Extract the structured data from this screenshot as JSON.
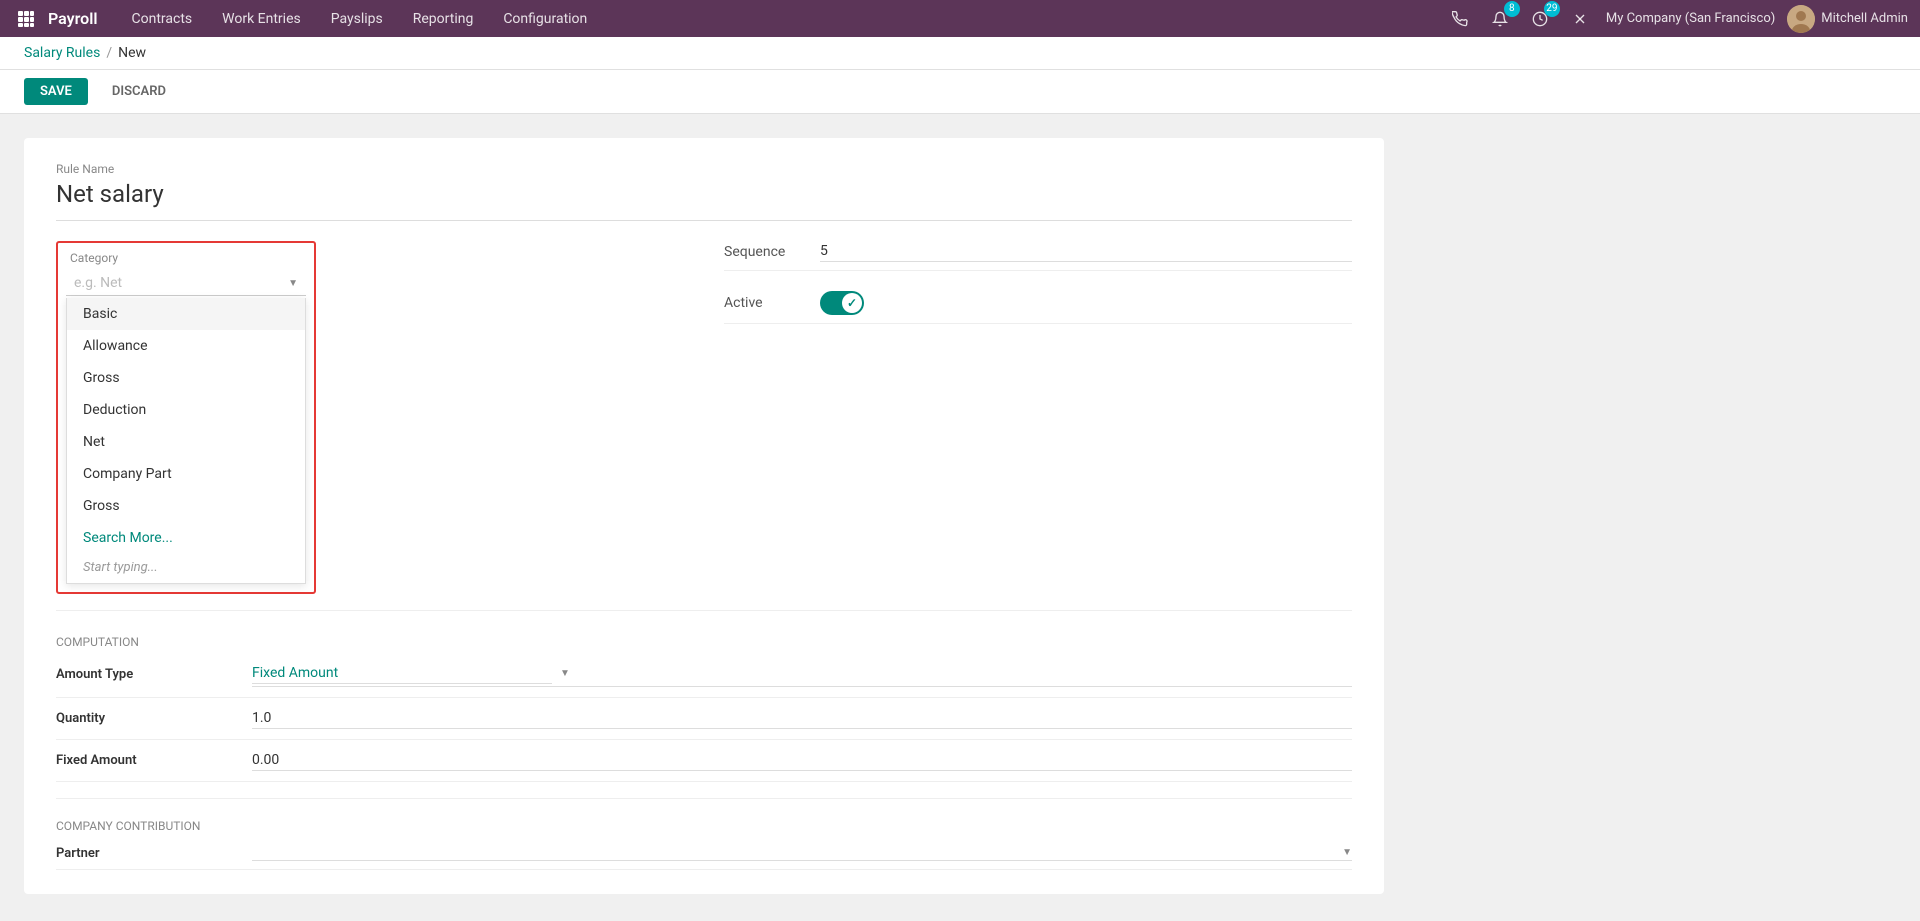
{
  "app": {
    "brand": "Payroll",
    "nav_items": [
      "Contracts",
      "Work Entries",
      "Payslips",
      "Reporting",
      "Configuration"
    ]
  },
  "header": {
    "breadcrumb_parent": "Salary Rules",
    "breadcrumb_separator": "/",
    "breadcrumb_current": "New"
  },
  "actions": {
    "save_label": "SAVE",
    "discard_label": "DISCARD"
  },
  "form": {
    "rule_name_label": "Rule Name",
    "rule_name_value": "Net salary",
    "category_label": "Category",
    "category_placeholder": "e.g. Net",
    "sequence_label": "Sequence",
    "sequence_value": "5",
    "active_label": "Active"
  },
  "dropdown": {
    "items": [
      "Basic",
      "Allowance",
      "Gross",
      "Deduction",
      "Net",
      "Company Part",
      "Gross"
    ],
    "search_more": "Search More...",
    "start_typing": "Start typing..."
  },
  "computation": {
    "section_title": "Computation",
    "amount_type_label": "Amount Type",
    "amount_type_value": "Fixed Amount",
    "quantity_label": "Quantity",
    "quantity_value": "1.0",
    "fixed_amount_label": "Fixed Amount",
    "fixed_amount_value": "0.00"
  },
  "company_contribution": {
    "section_title": "Company Contribution",
    "partner_label": "Partner"
  },
  "topnav": {
    "notifications_count": "8",
    "activity_count": "29",
    "company": "My Company (San Francisco)",
    "user": "Mitchell Admin"
  }
}
